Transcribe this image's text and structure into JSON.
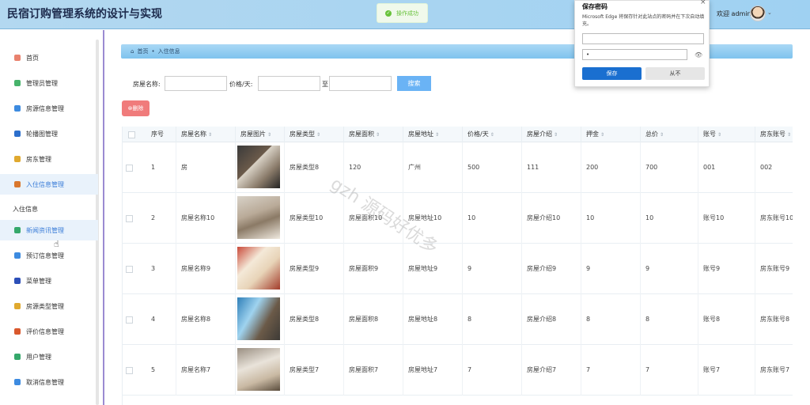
{
  "header": {
    "title": "民宿订购管理系统的设计与实现",
    "toast": "操作成功",
    "welcome": "欢迎 admin"
  },
  "sidebar": {
    "items": [
      {
        "label": "首页",
        "color": "#e9826e",
        "active": false
      },
      {
        "label": "管理员管理",
        "color": "#47b36b",
        "active": false
      },
      {
        "label": "房源信息管理",
        "color": "#3d8be0",
        "active": false
      },
      {
        "label": "轮播图管理",
        "color": "#2c6fcc",
        "active": false
      },
      {
        "label": "房东管理",
        "color": "#e0a92f",
        "active": false
      },
      {
        "label": "入住信息管理",
        "color": "#d9772d",
        "active": true
      }
    ],
    "group_label": "入住信息",
    "items2": [
      {
        "label": "新闻资讯管理",
        "color": "#35a86b",
        "active": true
      },
      {
        "label": "预订信息管理",
        "color": "#3d8be0",
        "active": false
      },
      {
        "label": "菜单管理",
        "color": "#2c4fb8",
        "active": false
      },
      {
        "label": "房源类型管理",
        "color": "#e0a92f",
        "active": false
      },
      {
        "label": "评价信息管理",
        "color": "#d9582d",
        "active": false
      },
      {
        "label": "用户管理",
        "color": "#35a86b",
        "active": false
      },
      {
        "label": "取消信息管理",
        "color": "#3d8be0",
        "active": false
      }
    ]
  },
  "breadcrumb": {
    "home": "首页",
    "sep": "•",
    "current": "入住信息"
  },
  "filters": {
    "name_label": "房屋名称:",
    "price_label": "价格/天:",
    "to_label": "至",
    "search_button": "搜索"
  },
  "toolbar": {
    "delete_button": "删除"
  },
  "table": {
    "columns": [
      "序号",
      "房屋名称",
      "房屋图片",
      "房屋类型",
      "房屋面积",
      "房屋地址",
      "价格/天",
      "房屋介绍",
      "押金",
      "总价",
      "账号",
      "房东账号"
    ],
    "rows": [
      [
        "1",
        "房",
        "",
        "房屋类型8",
        "120",
        "广州",
        "500",
        "111",
        "200",
        "700",
        "001",
        "002"
      ],
      [
        "2",
        "房屋名称10",
        "",
        "房屋类型10",
        "房屋面积10",
        "房屋地址10",
        "10",
        "房屋介绍10",
        "10",
        "10",
        "账号10",
        "房东账号10"
      ],
      [
        "3",
        "房屋名称9",
        "",
        "房屋类型9",
        "房屋面积9",
        "房屋地址9",
        "9",
        "房屋介绍9",
        "9",
        "9",
        "账号9",
        "房东账号9"
      ],
      [
        "4",
        "房屋名称8",
        "",
        "房屋类型8",
        "房屋面积8",
        "房屋地址8",
        "8",
        "房屋介绍8",
        "8",
        "8",
        "账号8",
        "房东账号8"
      ],
      [
        "5",
        "房屋名称7",
        "",
        "房屋类型7",
        "房屋面积7",
        "房屋地址7",
        "7",
        "房屋介绍7",
        "7",
        "7",
        "账号7",
        "房东账号7"
      ]
    ]
  },
  "watermark": "gzh 源码好优多",
  "password_popup": {
    "title": "保存密码",
    "description": "Microsoft Edge 将保存针对此站点的密码并在下次自动填充。",
    "password_value": "•",
    "save_button": "保存",
    "never_button": "从不"
  }
}
